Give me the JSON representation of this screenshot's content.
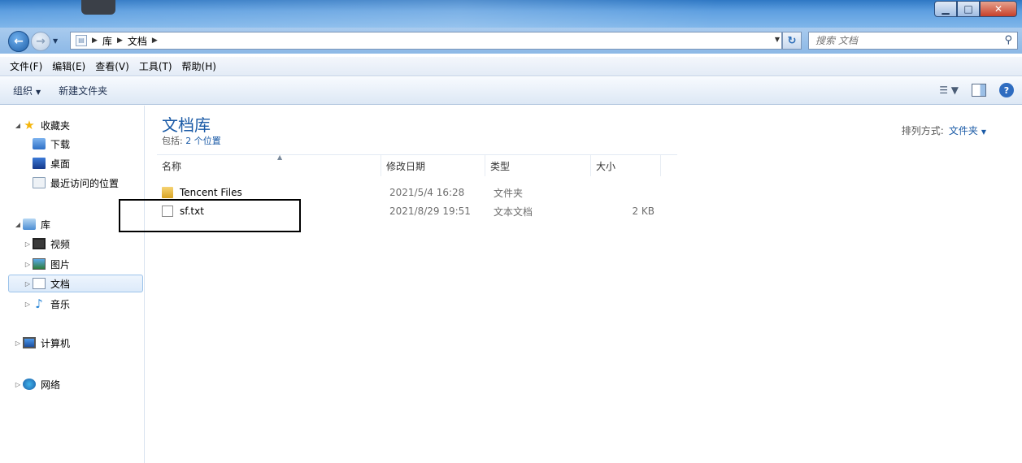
{
  "window": {
    "controls": {
      "minimize": "▁",
      "maximize": "□",
      "close": "✕"
    }
  },
  "address": {
    "crumbs": [
      "库",
      "文档"
    ],
    "search_placeholder": "搜索 文档"
  },
  "menu": [
    "文件(F)",
    "编辑(E)",
    "查看(V)",
    "工具(T)",
    "帮助(H)"
  ],
  "commands": {
    "organize": "组织",
    "new_folder": "新建文件夹"
  },
  "nav": {
    "favorites": "收藏夹",
    "downloads": "下载",
    "desktop": "桌面",
    "recent": "最近访问的位置",
    "libraries": "库",
    "videos": "视频",
    "pictures": "图片",
    "documents": "文档",
    "music": "音乐",
    "computer": "计算机",
    "network": "网络"
  },
  "library": {
    "title": "文档库",
    "includes_label": "包括:",
    "includes_link": "2 个位置",
    "arrange_label": "排列方式:",
    "arrange_value": "文件夹"
  },
  "columns": [
    "名称",
    "修改日期",
    "类型",
    "大小"
  ],
  "files": [
    {
      "name": "Tencent Files",
      "modified": "2021/5/4 16:28",
      "type": "文件夹",
      "size": "",
      "icon": "folder-icon"
    },
    {
      "name": "sf.txt",
      "modified": "2021/8/29 19:51",
      "type": "文本文档",
      "size": "2 KB",
      "icon": "text-file-icon"
    }
  ]
}
